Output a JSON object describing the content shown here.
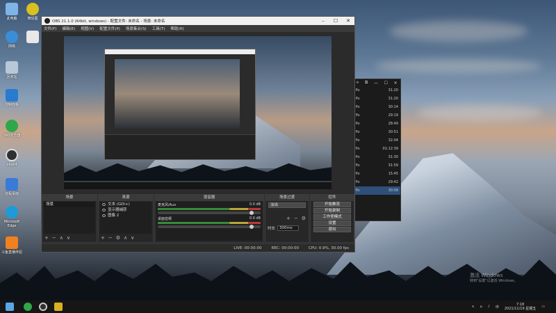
{
  "desktop_icons": [
    {
      "label": "此电脑"
    },
    {
      "label": "微信图"
    },
    {
      "label": "网络"
    },
    {
      "label": "回收站"
    },
    {
      "label": "控制面板"
    },
    {
      "label": "360浏览器"
    },
    {
      "label": "obs64"
    },
    {
      "label": "远程桌面"
    },
    {
      "label": "Microsoft Edge"
    },
    {
      "label": "斗鱼直播伴侣"
    }
  ],
  "obs": {
    "title": "OBS 21.1.0 (64bit, windows) - 配置文件: 未命名 - 场景: 未命名",
    "menu": [
      "文件(F)",
      "编辑(E)",
      "视图(V)",
      "配置文件(P)",
      "场景集合(S)",
      "工具(T)",
      "帮助(H)"
    ],
    "docks": {
      "scenes": {
        "title": "场景",
        "items": [
          "场景"
        ]
      },
      "sources": {
        "title": "来源",
        "items": [
          "文本 (GDI+)",
          "显示器捕获",
          "图像 2"
        ]
      },
      "mixer": {
        "title": "混音器",
        "channels": [
          {
            "name": "麦克风/Aux",
            "db": "0.0 dB"
          },
          {
            "name": "桌面音频",
            "db": "0.0 dB"
          }
        ]
      },
      "transitions": {
        "title": "场景过渡",
        "type": "淡出",
        "duration_label": "时长",
        "duration_value": "300ms"
      },
      "controls": {
        "title": "控件",
        "buttons": [
          "开始推流",
          "开始录制",
          "工作室模式",
          "设置",
          "退出"
        ]
      }
    },
    "status": {
      "live": "LIVE: 00:00:00",
      "rec": "REC: 00:00:00",
      "cpu": "CPU: 0.9%, 30.00 fps"
    }
  },
  "file_list": {
    "rows": [
      {
        "name": ".flv",
        "time": "31:20"
      },
      {
        "name": ".flv",
        "time": "31:20"
      },
      {
        "name": ".flv",
        "time": "30:14"
      },
      {
        "name": ".flv",
        "time": "29:19"
      },
      {
        "name": ".flv",
        "time": "28:49"
      },
      {
        "name": ".flv",
        "time": "30:51"
      },
      {
        "name": ".flv",
        "time": "32:04"
      },
      {
        "name": ".flv",
        "time": "01:12:39"
      },
      {
        "name": ".flv",
        "time": "31:30"
      },
      {
        "name": ".flv",
        "time": "31:59"
      },
      {
        "name": ".flv",
        "time": "15:45"
      },
      {
        "name": ".flv",
        "time": "29:42"
      },
      {
        "name": ".flv",
        "time": "30:09"
      }
    ]
  },
  "watermark": {
    "line1": "激活 Windows",
    "line2": "转到\"设置\"以激活 Windows。"
  },
  "taskbar": {
    "ime": "中",
    "time": "7:18",
    "date": "2021/11/19 星期五"
  }
}
